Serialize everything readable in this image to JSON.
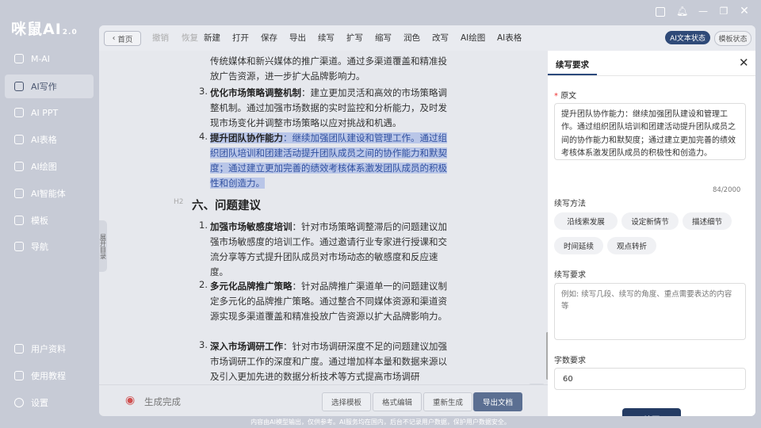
{
  "app": {
    "logo": "咪鼠AI",
    "version": "2.0"
  },
  "sidebar": {
    "items": [
      {
        "label": "M-AI",
        "icon": "chat-icon"
      },
      {
        "label": "AI写作",
        "icon": "write-icon"
      },
      {
        "label": "AI PPT",
        "icon": "ppt-icon"
      },
      {
        "label": "AI表格",
        "icon": "table-icon"
      },
      {
        "label": "AI绘图",
        "icon": "paint-icon"
      },
      {
        "label": "AI智能体",
        "icon": "agent-icon"
      },
      {
        "label": "模板",
        "icon": "template-icon"
      },
      {
        "label": "导航",
        "icon": "navigation-icon"
      }
    ],
    "bottom_items": [
      {
        "label": "用户资料",
        "icon": "user-icon"
      },
      {
        "label": "使用教程",
        "icon": "tutorial-icon"
      },
      {
        "label": "设置",
        "icon": "gear-icon"
      }
    ]
  },
  "toolbar": {
    "back": "首页",
    "undo": "撤销",
    "redo": "恢复",
    "buttons": [
      "新建",
      "打开",
      "保存",
      "导出",
      "续写",
      "扩写",
      "缩写",
      "润色",
      "改写",
      "AI绘图",
      "AI表格"
    ],
    "mode_ai": "AI文本状态",
    "mode_template": "模板状态"
  },
  "document": {
    "intro_tail": "传统媒体和新兴媒体的推广渠道。通过多渠道覆盖和精准投放广告资源，进一步扩大品牌影响力。",
    "items_a": [
      {
        "num": "3.",
        "title": "优化市场策略调整机制",
        "text": "：建立更加灵活和高效的市场策略调整机制。通过加强市场数据的实时监控和分析能力，及时发现市场变化并调整市场策略以应对挑战和机遇。"
      },
      {
        "num": "4.",
        "title": "提升团队协作能力",
        "text": "：继续加强团队建设和管理工作。通过组织团队培训和团建活动提升团队成员之间的协作能力和默契度；通过建立更加完善的绩效考核体系激发团队成员的积极性和创造力。"
      }
    ],
    "h2_tag": "H2",
    "heading": "六、问题建议",
    "items_b": [
      {
        "num": "1.",
        "title": "加强市场敏感度培训",
        "text": "：针对市场策略调整滞后的问题建议加强市场敏感度的培训工作。通过邀请行业专家进行授课和交流分享等方式提升团队成员对市场动态的敏感度和反应速度。"
      },
      {
        "num": "2.",
        "title": "多元化品牌推广策略",
        "text": "：针对品牌推广渠道单一的问题建议制定多元化的品牌推广策略。通过整合不同媒体资源和渠道资源实现多渠道覆盖和精准投放广告资源以扩大品牌影响力。"
      },
      {
        "num": "3.",
        "title": "深入市场调研工作",
        "text": "：针对市场调研深度不足的问题建议加强市场调研工作的深度和广度。通过增加样本量和数据来源以及引入更加先进的数据分析技术等方式提高市场调研"
      }
    ],
    "side_handle": "展开目录"
  },
  "bottom_bar": {
    "status": "生成完成",
    "buttons": [
      "选择模板",
      "格式编辑",
      "重新生成"
    ],
    "export": "导出文档"
  },
  "panel": {
    "tab": "续写要求",
    "original_label": "原文",
    "original_text": "提升团队协作能力：继续加强团队建设和管理工作。通过组织团队培训和团建活动提升团队成员之间的协作能力和默契度；通过建立更加完善的绩效考核体系激发团队成员的积极性和创造力。",
    "char_count": "84/2000",
    "method_label": "续写方法",
    "methods": [
      "沿线索发展",
      "设定新情节",
      "描述细节",
      "时间延续",
      "观点转折"
    ],
    "requirement_label": "续写要求",
    "requirement_placeholder": "例如: 续写几段、续写的角度、重点需要表达的内容等",
    "word_label": "字数要求",
    "word_value": "60",
    "submit": "续写"
  },
  "footer": "内容由AI模型输出，仅供参考。AI服务均在国内，后台不记录用户数据，保护用户数据安全。"
}
